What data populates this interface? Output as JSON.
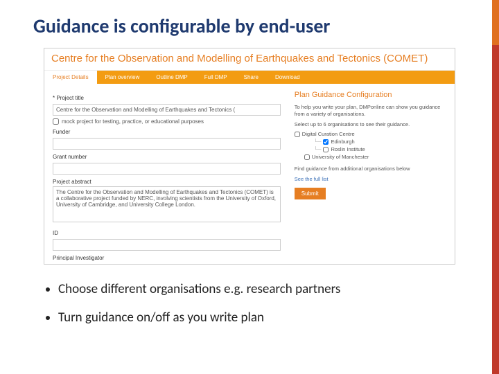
{
  "slide": {
    "title": "Guidance is configurable by end-user",
    "bullets": [
      "Choose different organisations e.g. research partners",
      "Turn guidance on/off as you write plan"
    ]
  },
  "app": {
    "header": "Centre for the Observation and Modelling of Earthquakes and Tectonics (COMET)",
    "tabs": [
      "Project Details",
      "Plan overview",
      "Outline DMP",
      "Full DMP",
      "Share",
      "Download"
    ],
    "fields": {
      "project_title_label": "Project title",
      "project_title_value": "Centre for the Observation and Modelling of Earthquakes and Tectonics (",
      "mock_label": "mock project for testing, practice, or educational purposes",
      "funder_label": "Funder",
      "grant_label": "Grant number",
      "abstract_label": "Project abstract",
      "abstract_value": "The Centre for the Observation and Modelling of Earthquakes and Tectonics (COMET) is a collaborative project funded by NERC, involving scientists from the University of Oxford, University of Cambridge, and University College London.",
      "id_label": "ID",
      "pi_label": "Principal Investigator"
    },
    "guidance": {
      "title": "Plan Guidance Configuration",
      "intro": "To help you write your plan, DMPonline can show you guidance from a variety of organisations.",
      "select_hint": "Select up to 6 organisations to see their guidance.",
      "orgs": {
        "dcc": "Digital Curation Centre",
        "edinburgh": "Edinburgh",
        "roslin": "Roslin Institute",
        "manchester": "University of Manchester"
      },
      "find_more": "Find guidance from additional organisations below",
      "full_list": "See the full list",
      "submit": "Submit"
    }
  }
}
